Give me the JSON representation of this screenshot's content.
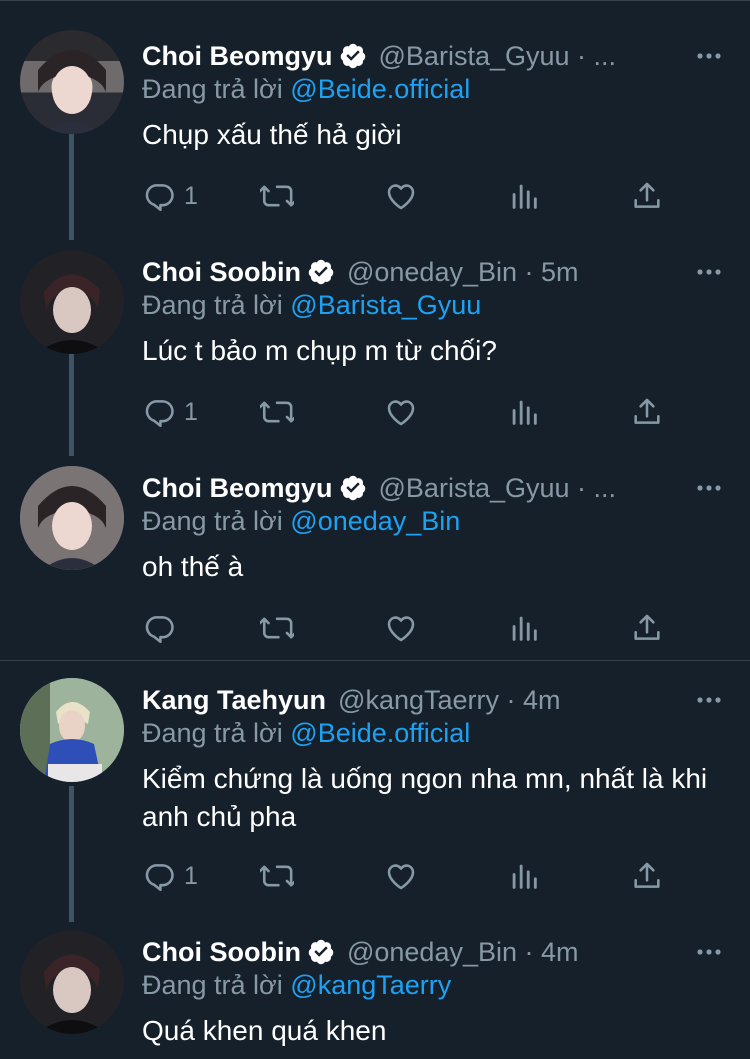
{
  "tweets": [
    {
      "name": "Choi Beomgyu",
      "handle": "@Barista_Gyuu · ...",
      "reply_label": "Đang trả lời",
      "reply_mention": "@Beide.official",
      "text": "Chụp xấu thế hả giời",
      "reply_count": "1"
    },
    {
      "name": "Choi Soobin",
      "handle": "@oneday_Bin · 5m",
      "reply_label": "Đang trả lời",
      "reply_mention": "@Barista_Gyuu",
      "text": "Lúc t bảo m chụp m từ chối?",
      "reply_count": "1"
    },
    {
      "name": "Choi Beomgyu",
      "handle": "@Barista_Gyuu · ...",
      "reply_label": "Đang trả lời",
      "reply_mention": "@oneday_Bin",
      "text": "oh thế à",
      "reply_count": ""
    },
    {
      "name": "Kang Taehyun",
      "handle": "@kangTaerry · 4m",
      "reply_label": "Đang trả lời",
      "reply_mention": "@Beide.official",
      "text": "Kiểm chứng là uống ngon nha mn, nhất là khi anh chủ pha",
      "reply_count": "1"
    },
    {
      "name": "Choi Soobin",
      "handle": "@oneday_Bin · 4m",
      "reply_label": "Đang trả lời",
      "reply_mention": "@kangTaerry",
      "text": "Quá khen quá khen",
      "reply_count": ""
    }
  ],
  "icons": [
    "verified-badge-icon",
    "more-options-icon",
    "reply-icon",
    "retweet-icon",
    "like-icon",
    "analytics-icon",
    "share-icon"
  ],
  "colors": {
    "background": "#15202b",
    "muted": "#8899a6",
    "link": "#1da1f2",
    "thread_line": "#3d5466"
  }
}
